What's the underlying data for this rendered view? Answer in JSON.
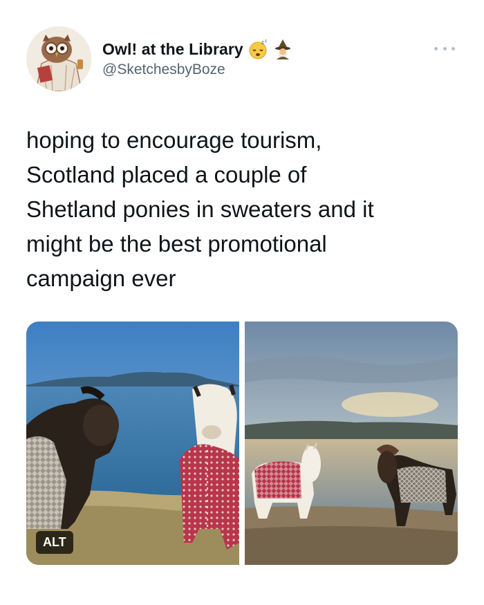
{
  "author": {
    "display_name": "Owl! at the Library",
    "handle": "@SketchesbyBoze",
    "emojis": [
      "sleeping-face-icon",
      "mage-icon"
    ]
  },
  "tweet": {
    "text": "hoping to encourage tourism,\nScotland placed a couple of\nShetland ponies in sweaters and it\nmight be the best promotional\ncampaign ever"
  },
  "media": {
    "alt_label": "ALT",
    "photos": [
      "pony-photo-seaside",
      "pony-photo-sunset"
    ]
  },
  "colors": {
    "text": "#0f1419",
    "secondary": "#536471",
    "sweater_red": "#b8364a",
    "sweater_grey": "#8a8478"
  }
}
